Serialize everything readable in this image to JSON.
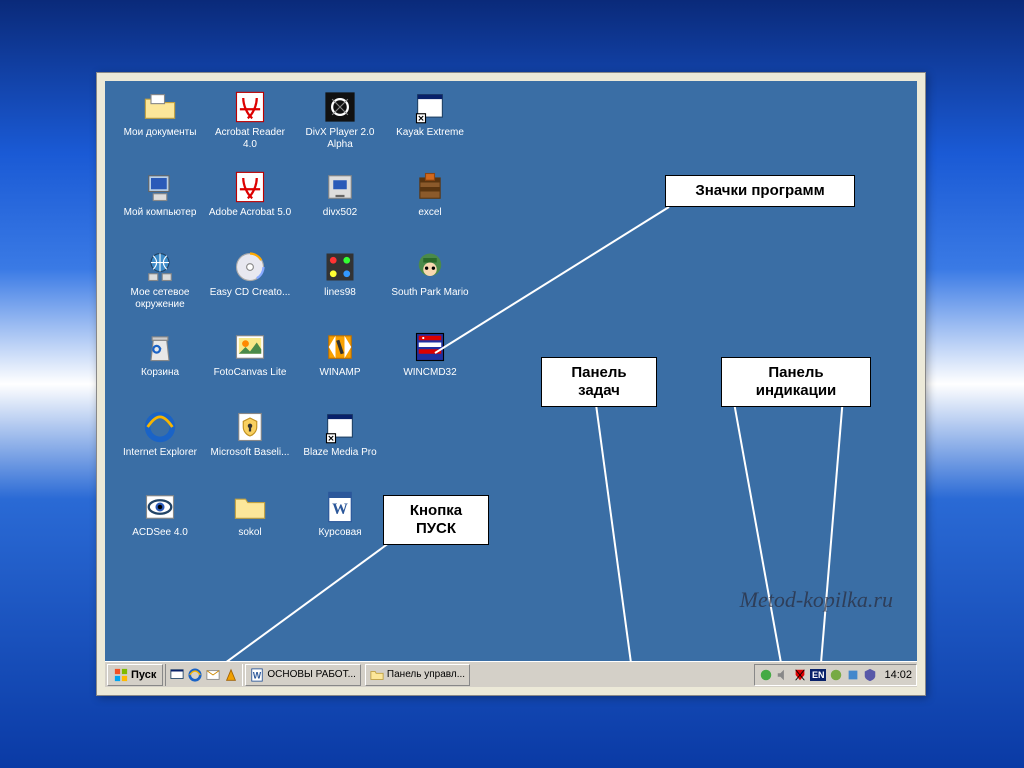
{
  "icons": [
    {
      "label": "Мои документы",
      "type": "folder-docs"
    },
    {
      "label": "Acrobat Reader 4.0",
      "type": "acrobat"
    },
    {
      "label": "DivX Player 2.0 Alpha",
      "type": "divx"
    },
    {
      "label": "Kayak Extreme",
      "type": "app-generic"
    },
    {
      "label": "Мой компьютер",
      "type": "computer"
    },
    {
      "label": "Adobe Acrobat 5.0",
      "type": "acrobat"
    },
    {
      "label": "divx502",
      "type": "installer"
    },
    {
      "label": "excel",
      "type": "winrar"
    },
    {
      "label": "Мое сетевое окружение",
      "type": "network"
    },
    {
      "label": "Easy CD Creato...",
      "type": "cd"
    },
    {
      "label": "lines98",
      "type": "lines"
    },
    {
      "label": "South Park Mario",
      "type": "southpark"
    },
    {
      "label": "Корзина",
      "type": "recycle"
    },
    {
      "label": "FotoCanvas Lite",
      "type": "foto"
    },
    {
      "label": "WINAMP",
      "type": "winamp"
    },
    {
      "label": "WINCMD32",
      "type": "wincmd"
    },
    {
      "label": "Internet Explorer",
      "type": "ie"
    },
    {
      "label": "Microsoft Baseli...",
      "type": "msb"
    },
    {
      "label": "Blaze Media Pro",
      "type": "app-generic"
    },
    {
      "label": "",
      "type": "empty"
    },
    {
      "label": "ACDSee 4.0",
      "type": "acdsee"
    },
    {
      "label": "sokol",
      "type": "folder"
    },
    {
      "label": "Курсовая",
      "type": "word"
    }
  ],
  "callouts": {
    "programs": "Значки программ",
    "taskbar": "Панель задач",
    "tray": "Панель индикации",
    "start": "Кнопка ПУСК"
  },
  "watermark": "Metod-kopilka.ru",
  "taskbar": {
    "start": "Пуск",
    "items": [
      {
        "label": "ОСНОВЫ РАБОТ..."
      },
      {
        "label": "Панель управл..."
      }
    ],
    "clock": "14:02",
    "lang": "EN"
  }
}
